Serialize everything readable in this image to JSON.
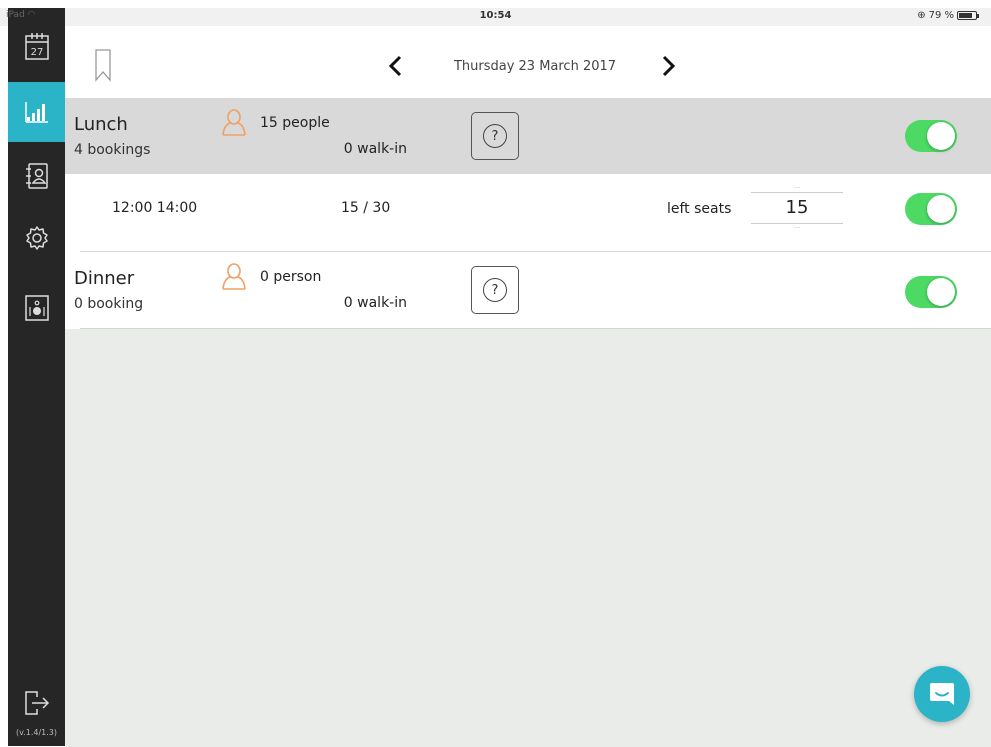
{
  "status_bar": {
    "device": "iPad",
    "time": "10:54",
    "battery": "79 %",
    "battery_level": 0.79
  },
  "sidebar": {
    "calendar_day": "27",
    "version": "(v.1.4/1.3)",
    "active_item": "stats"
  },
  "header": {
    "date": "Thursday 23 March 2017"
  },
  "services": [
    {
      "name": "Lunch",
      "bookings": "4 bookings",
      "people": "15 people",
      "walkin": "0 walk-in",
      "help": "?",
      "enabled": true
    },
    {
      "name": "Dinner",
      "bookings": "0 booking",
      "people": "0 person",
      "walkin": "0 walk-in",
      "help": "?",
      "enabled": true
    }
  ],
  "lunch_slot": {
    "times": "12:00  14:00",
    "count": "15 / 30",
    "left_seats_label": "left seats",
    "left_seats": "15",
    "enabled": true
  },
  "colors": {
    "sidebar": "#262626",
    "accent": "#2bb3c7",
    "toggle_on": "#4cd964",
    "person_icon": "#f0a064",
    "selected_row": "#d9d9d9",
    "empty_area": "#e9ece8"
  }
}
